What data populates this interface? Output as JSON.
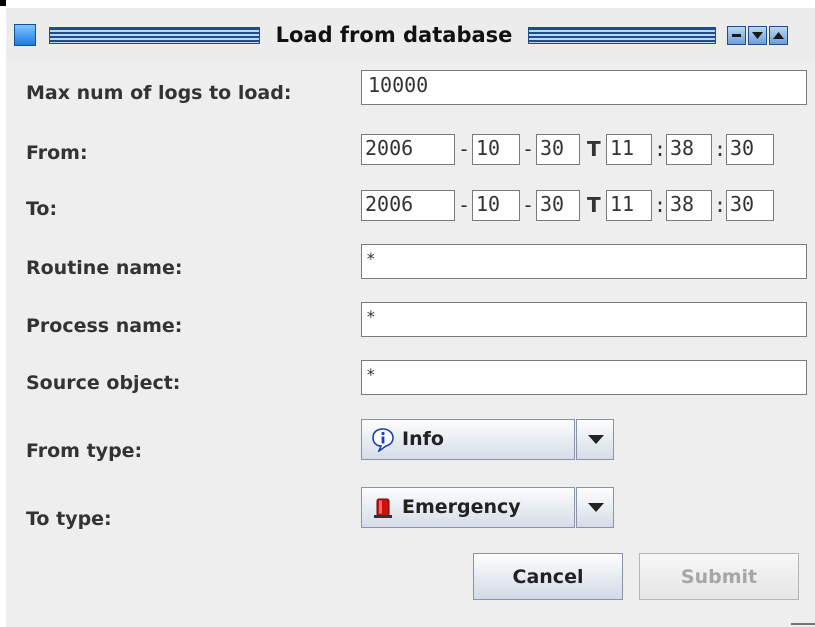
{
  "window": {
    "title": "Load from database"
  },
  "form": {
    "max_logs_label": "Max num of logs to load:",
    "max_logs_value": "10000",
    "from_label": "From:",
    "to_label": "To:",
    "from_datetime": {
      "year": "2006",
      "month": "10",
      "day": "30",
      "hour": "11",
      "minute": "38",
      "second": "30"
    },
    "to_datetime": {
      "year": "2006",
      "month": "10",
      "day": "30",
      "hour": "11",
      "minute": "38",
      "second": "30"
    },
    "date_sep": "-",
    "datetime_sep": "T",
    "time_sep": ":",
    "routine_label": "Routine name:",
    "routine_value": "*",
    "process_label": "Process name:",
    "process_value": "*",
    "source_label": "Source object:",
    "source_value": "*",
    "from_type_label": "From type:",
    "from_type_value": "Info",
    "from_type_icon": "info-icon",
    "to_type_label": "To type:",
    "to_type_value": "Emergency",
    "to_type_icon": "emergency-icon"
  },
  "buttons": {
    "cancel": "Cancel",
    "submit": "Submit"
  },
  "colors": {
    "title_stripe": "#1f4c8f",
    "info_icon": "#1a3fbf",
    "emergency_icon": "#cc1111"
  }
}
